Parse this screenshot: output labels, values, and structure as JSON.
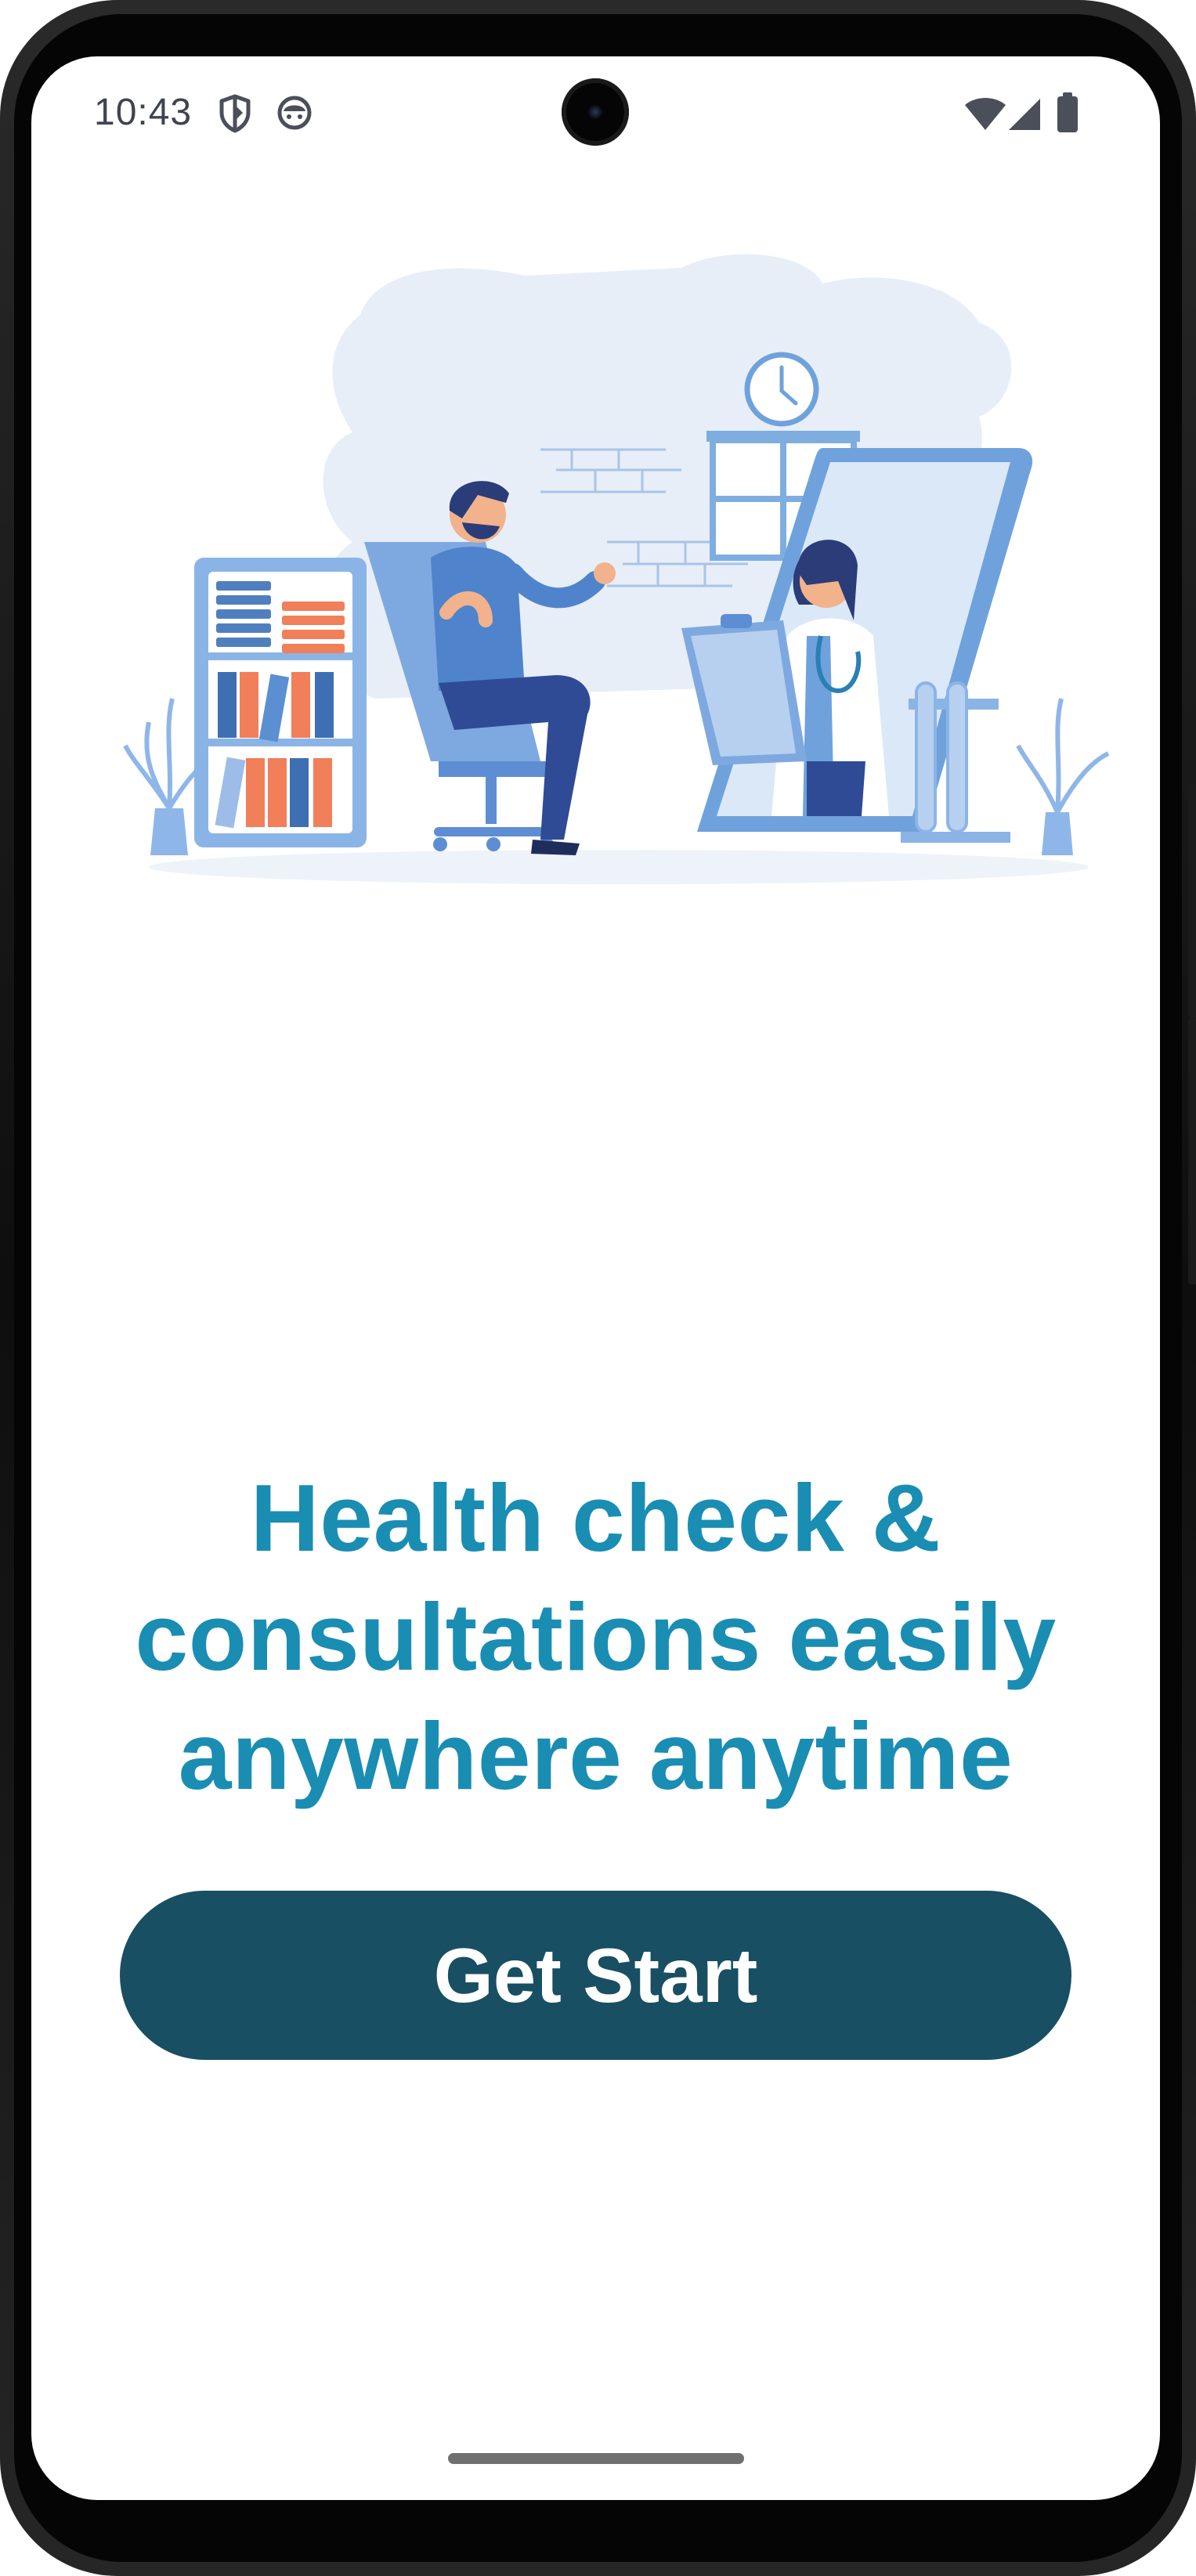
{
  "status_bar": {
    "time": "10:43",
    "icons": [
      "shield-icon",
      "android-face-icon",
      "wifi-icon",
      "signal-icon",
      "battery-icon"
    ]
  },
  "illustration": {
    "subject": "doctor-video-consultation-illustration"
  },
  "headline": {
    "line1": "Health check &",
    "line2": "consultations easily",
    "line3": "anywhere anytime"
  },
  "cta": {
    "label": "Get Start"
  },
  "colors": {
    "headline": "#1a8db3",
    "button": "#184f62",
    "button_text": "#ffffff",
    "background": "#ffffff"
  }
}
